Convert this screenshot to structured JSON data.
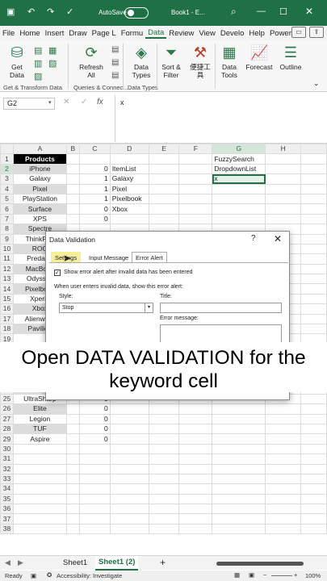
{
  "titlebar": {
    "autosave": "AutoSave",
    "autosave_state": "Off",
    "book": "Book1 - E..."
  },
  "tabs": [
    "File",
    "Home",
    "Insert",
    "Draw",
    "Page L",
    "Formu",
    "Data",
    "Review",
    "View",
    "Develo",
    "Help",
    "Power"
  ],
  "active_tab": "Data",
  "ribbon": {
    "get_data": "Get Data",
    "refresh_all": "Refresh All",
    "data_types": "Data Types",
    "sort_filter": "Sort & Filter",
    "custom_tool": "便捷工具",
    "data_tools": "Data Tools",
    "forecast": "Forecast",
    "outline": "Outline",
    "grp_transform": "Get & Transform Data",
    "grp_queries": "Queries & Connec...",
    "grp_datatypes": "Data Types"
  },
  "formula_bar": {
    "name_box": "G2",
    "fx": "fx",
    "value": "x"
  },
  "columns": [
    "A",
    "B",
    "C",
    "D",
    "E",
    "F",
    "G",
    "H"
  ],
  "rows": [
    {
      "n": "1",
      "a": "Products",
      "c": "",
      "d": "",
      "g": "FuzzySearch"
    },
    {
      "n": "2",
      "a": "iPhone",
      "c": "0",
      "d": "ItemList",
      "g": "DropdownList"
    },
    {
      "n": "3",
      "a": "Galaxy",
      "c": "1",
      "d": "Galaxy",
      "g": "x"
    },
    {
      "n": "4",
      "a": "Pixel",
      "c": "1",
      "d": "Pixel",
      "g": ""
    },
    {
      "n": "5",
      "a": "PlayStation",
      "c": "1",
      "d": "Pixelbook",
      "g": ""
    },
    {
      "n": "6",
      "a": "Surface",
      "c": "0",
      "d": "Xbox",
      "g": ""
    },
    {
      "n": "7",
      "a": "XPS",
      "c": "0",
      "d": "",
      "g": ""
    },
    {
      "n": "8",
      "a": "Spectre",
      "c": "",
      "d": "",
      "g": ""
    },
    {
      "n": "9",
      "a": "ThinkPad",
      "c": "",
      "d": "",
      "g": ""
    },
    {
      "n": "10",
      "a": "ROG",
      "c": "",
      "d": "",
      "g": ""
    },
    {
      "n": "11",
      "a": "Predator",
      "c": "",
      "d": "",
      "g": ""
    },
    {
      "n": "12",
      "a": "MacBook",
      "c": "",
      "d": "",
      "g": ""
    },
    {
      "n": "13",
      "a": "Odyssey",
      "c": "",
      "d": "",
      "g": ""
    },
    {
      "n": "14",
      "a": "Pixelbook",
      "c": "",
      "d": "",
      "g": ""
    },
    {
      "n": "15",
      "a": "Xperia",
      "c": "",
      "d": "",
      "g": ""
    },
    {
      "n": "16",
      "a": "Xbox",
      "c": "",
      "d": "",
      "g": ""
    },
    {
      "n": "17",
      "a": "Alienware",
      "c": "",
      "d": "",
      "g": ""
    },
    {
      "n": "18",
      "a": "Pavilion",
      "c": "",
      "d": "",
      "g": ""
    },
    {
      "n": "19",
      "a": "",
      "c": "",
      "d": "",
      "g": ""
    },
    {
      "n": "20",
      "a": "",
      "c": "",
      "d": "",
      "g": ""
    },
    {
      "n": "21",
      "a": "",
      "c": "",
      "d": "",
      "g": ""
    },
    {
      "n": "22",
      "a": "",
      "c": "",
      "d": "",
      "g": ""
    },
    {
      "n": "23",
      "a": "",
      "c": "",
      "d": "",
      "g": ""
    },
    {
      "n": "24",
      "a": "WH",
      "c": "0",
      "d": "",
      "g": ""
    },
    {
      "n": "25",
      "a": "UltraSharp",
      "c": "0",
      "d": "",
      "g": ""
    },
    {
      "n": "26",
      "a": "Elite",
      "c": "0",
      "d": "",
      "g": ""
    },
    {
      "n": "27",
      "a": "Legion",
      "c": "0",
      "d": "",
      "g": ""
    },
    {
      "n": "28",
      "a": "TUF",
      "c": "0",
      "d": "",
      "g": ""
    },
    {
      "n": "29",
      "a": "Aspire",
      "c": "0",
      "d": "",
      "g": ""
    },
    {
      "n": "30",
      "a": "",
      "c": "",
      "d": "",
      "g": ""
    },
    {
      "n": "31",
      "a": "",
      "c": "",
      "d": "",
      "g": ""
    },
    {
      "n": "32",
      "a": "",
      "c": "",
      "d": "",
      "g": ""
    },
    {
      "n": "33",
      "a": "",
      "c": "",
      "d": "",
      "g": ""
    },
    {
      "n": "34",
      "a": "",
      "c": "",
      "d": "",
      "g": ""
    },
    {
      "n": "35",
      "a": "",
      "c": "",
      "d": "",
      "g": ""
    },
    {
      "n": "36",
      "a": "",
      "c": "",
      "d": "",
      "g": ""
    },
    {
      "n": "37",
      "a": "",
      "c": "",
      "d": "",
      "g": ""
    },
    {
      "n": "38",
      "a": "",
      "c": "",
      "d": "",
      "g": ""
    }
  ],
  "dialog": {
    "title": "Data Validation",
    "help": "?",
    "close": "✕",
    "tab_settings": "Settings",
    "tab_input": "Input Message",
    "tab_error": "Error Alert",
    "show_alert": "Show error alert after invalid data has been entered",
    "when_text": "When user enters invalid data, show this error alert:",
    "style_label": "Style:",
    "style_value": "Stop",
    "title_label": "Title:",
    "msg_label": "Error message:"
  },
  "caption": "Open DATA VALIDATION for the keyword cell",
  "sheets": {
    "sheet1": "Sheet1",
    "sheet2": "Sheet1 (2)",
    "add": "+"
  },
  "status": {
    "ready": "Ready",
    "accessibility": "Accessibility: Investigate",
    "zoom": "100%"
  }
}
